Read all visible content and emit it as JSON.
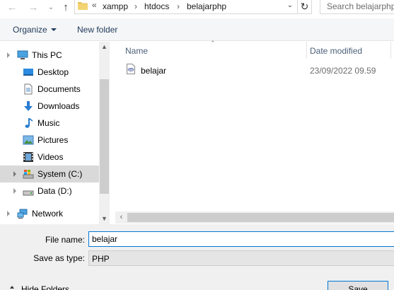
{
  "address_bar": {
    "overflow_marker": "«",
    "crumbs": [
      "xampp",
      "htdocs",
      "belajarphp"
    ],
    "search_placeholder": "Search belajarphp"
  },
  "toolbar": {
    "organize_label": "Organize",
    "new_folder_label": "New folder"
  },
  "nav_pane": {
    "items": [
      {
        "label": "This PC",
        "icon": "computer-icon"
      },
      {
        "label": "Desktop",
        "icon": "desktop-icon"
      },
      {
        "label": "Documents",
        "icon": "documents-icon"
      },
      {
        "label": "Downloads",
        "icon": "downloads-icon"
      },
      {
        "label": "Music",
        "icon": "music-icon"
      },
      {
        "label": "Pictures",
        "icon": "pictures-icon"
      },
      {
        "label": "Videos",
        "icon": "videos-icon"
      },
      {
        "label": "System (C:)",
        "icon": "drive-c-icon",
        "selected": true
      },
      {
        "label": "Data (D:)",
        "icon": "drive-icon"
      },
      {
        "label": "Network",
        "icon": "network-icon"
      }
    ]
  },
  "file_list": {
    "columns": [
      "Name",
      "Date modified"
    ],
    "rows": [
      {
        "name": "belajar",
        "date_modified": "23/09/2022 09.59",
        "icon": "php-file-icon"
      }
    ]
  },
  "form": {
    "file_name_label": "File name:",
    "file_name_value": "belajar",
    "save_as_type_label": "Save as type:",
    "save_as_type_value": "PHP",
    "hide_folders_label": "Hide Folders",
    "save_button_label": "Save"
  },
  "colors": {
    "accent": "#0078d7",
    "selected_bg": "#d9d9d9",
    "toolbar_bg": "#f5f6f7",
    "form_bg": "#f0f0f0"
  }
}
